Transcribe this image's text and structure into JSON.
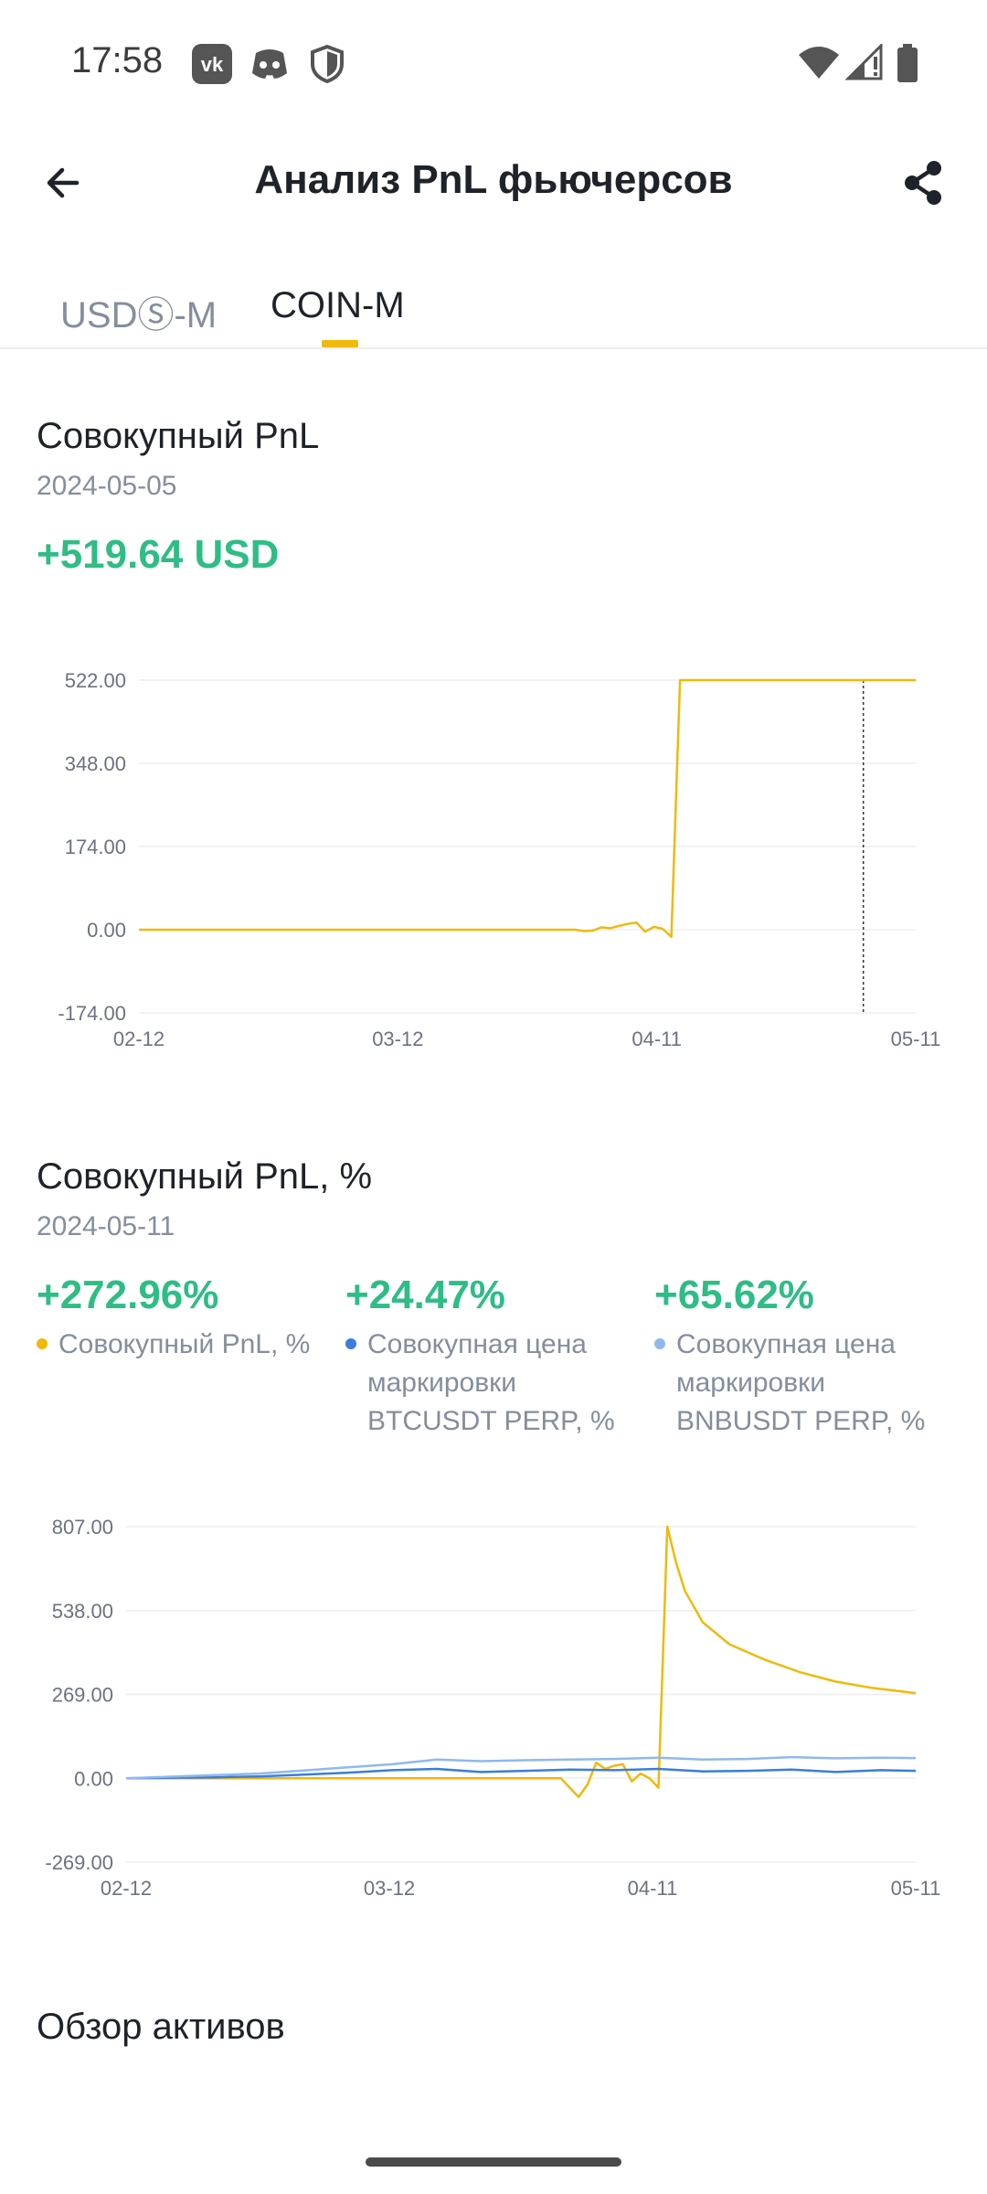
{
  "status_bar": {
    "time": "17:58",
    "icons": [
      "vk-icon",
      "discord-icon",
      "shield-icon",
      "wifi-icon",
      "signal-icon",
      "battery-icon"
    ]
  },
  "header": {
    "title": "Анализ PnL фьючерсов",
    "back_icon": "arrow-left-icon",
    "share_icon": "share-icon"
  },
  "tabs": [
    {
      "label": "USDⓈ-M",
      "active": false
    },
    {
      "label": "COIN-M",
      "active": true
    }
  ],
  "colors": {
    "accent": "#f0b90b",
    "positive": "#2ebd85",
    "series_btc": "#3b7ddd",
    "series_bnb": "#90b8ee"
  },
  "section1": {
    "title": "Совокупный PnL",
    "date": "2024-05-05",
    "value": "+519.64 USD"
  },
  "section2": {
    "title": "Совокупный PnL, %",
    "date": "2024-05-11",
    "legend": [
      {
        "value": "+272.96%",
        "label": "Совокупный PnL, %",
        "color": "#f0b90b"
      },
      {
        "value": "+24.47%",
        "label": "Совокупная цена маркировки BTCUSDT PERP, %",
        "color": "#3b7ddd"
      },
      {
        "value": "+65.62%",
        "label": "Совокупная цена маркировки BNBUSDT PERP, %",
        "color": "#90b8ee"
      }
    ]
  },
  "section3": {
    "title": "Обзор активов"
  },
  "chart_data": [
    {
      "type": "line",
      "title": "Совокупный PnL",
      "x_ticks": [
        "02-12",
        "03-12",
        "04-11",
        "05-11"
      ],
      "y_ticks": [
        "522.00",
        "348.00",
        "174.00",
        "0.00",
        "-174.00"
      ],
      "ylim": [
        -174,
        522
      ],
      "xlim": [
        0,
        89
      ],
      "grid": true,
      "crosshair_x": 83,
      "series": [
        {
          "color": "#f0b90b",
          "x": [
            0,
            50,
            51,
            52,
            53,
            54,
            55,
            56,
            57,
            58,
            59,
            60,
            61,
            62,
            63,
            64,
            89
          ],
          "y": [
            0,
            0,
            -3,
            -2,
            5,
            3,
            8,
            12,
            15,
            -4,
            6,
            2,
            -15,
            522,
            522,
            522,
            522
          ]
        }
      ]
    },
    {
      "type": "line",
      "title": "Совокупный PnL, %",
      "x_ticks": [
        "02-12",
        "03-12",
        "04-11",
        "05-11"
      ],
      "y_ticks": [
        "807.00",
        "538.00",
        "269.00",
        "0.00",
        "-269.00"
      ],
      "ylim": [
        -269,
        807
      ],
      "xlim": [
        0,
        89
      ],
      "grid": true,
      "series": [
        {
          "name": "Совокупный PnL, %",
          "color": "#f0b90b",
          "x": [
            0,
            49,
            50,
            51,
            52,
            53,
            54,
            55,
            56,
            57,
            58,
            59,
            60,
            61,
            62,
            63,
            65,
            68,
            72,
            76,
            80,
            84,
            89
          ],
          "y": [
            0,
            0,
            -30,
            -60,
            -20,
            50,
            30,
            40,
            45,
            -10,
            15,
            0,
            -30,
            807,
            690,
            600,
            500,
            430,
            380,
            340,
            310,
            290,
            273
          ]
        },
        {
          "name": "Совокупная цена маркировки BTCUSDT PERP, %",
          "color": "#3b7ddd",
          "x": [
            0,
            5,
            10,
            15,
            20,
            25,
            30,
            35,
            40,
            45,
            50,
            55,
            60,
            65,
            70,
            75,
            80,
            85,
            89
          ],
          "y": [
            0,
            2,
            3,
            6,
            12,
            18,
            26,
            30,
            20,
            24,
            28,
            26,
            30,
            22,
            24,
            28,
            20,
            26,
            24
          ]
        },
        {
          "name": "Совокупная цена маркировки BNBUSDT PERP, %",
          "color": "#90b8ee",
          "x": [
            0,
            5,
            10,
            15,
            20,
            25,
            30,
            35,
            40,
            45,
            50,
            55,
            60,
            65,
            70,
            75,
            80,
            85,
            89
          ],
          "y": [
            0,
            5,
            10,
            15,
            25,
            35,
            45,
            60,
            55,
            58,
            60,
            62,
            66,
            60,
            62,
            68,
            64,
            66,
            65
          ]
        }
      ]
    }
  ]
}
